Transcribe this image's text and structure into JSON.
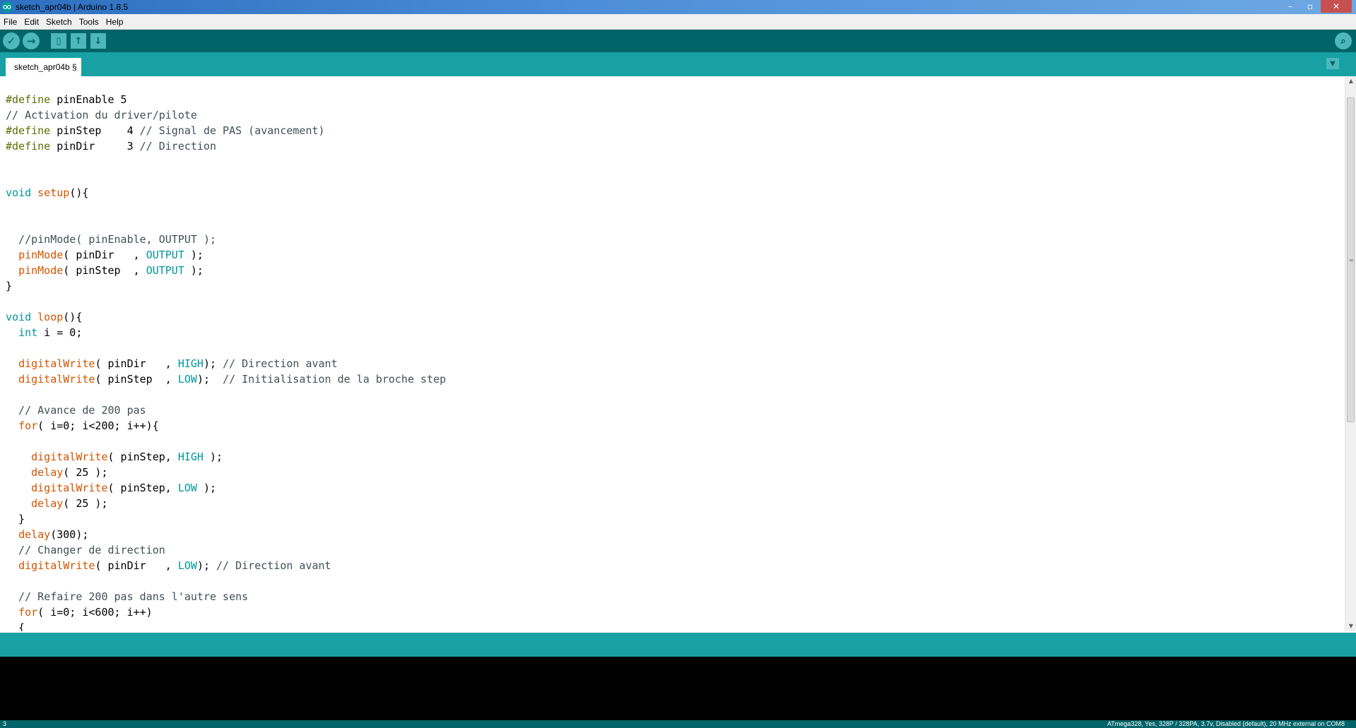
{
  "window": {
    "title": "sketch_apr04b | Arduino 1.8.5",
    "controls": {
      "minimize": "–",
      "maximize": "▫",
      "close": "✕"
    }
  },
  "menu": {
    "items": [
      "File",
      "Edit",
      "Sketch",
      "Tools",
      "Help"
    ]
  },
  "toolbar": {
    "verify_icon": "✓",
    "upload_icon": "→",
    "new_icon": "▯",
    "open_icon": "↑",
    "save_icon": "↓",
    "serial_monitor_icon": "⌕"
  },
  "tabs": {
    "active_label": "sketch_apr04b §",
    "menu_icon": "▼"
  },
  "code": [
    [
      {
        "t": "#define",
        "c": "k-pp"
      },
      {
        "t": " pinEnable 5"
      }
    ],
    [
      {
        "t": "// Activation du driver/pilote",
        "c": "k-cmt"
      }
    ],
    [
      {
        "t": "#define",
        "c": "k-pp"
      },
      {
        "t": " pinStep    4 "
      },
      {
        "t": "// Signal de PAS (avancement)",
        "c": "k-cmt"
      }
    ],
    [
      {
        "t": "#define",
        "c": "k-pp"
      },
      {
        "t": " pinDir     3 "
      },
      {
        "t": "// Direction",
        "c": "k-cmt"
      }
    ],
    [],
    [],
    [
      {
        "t": "void",
        "c": "k-type"
      },
      {
        "t": " "
      },
      {
        "t": "setup",
        "c": "k-fn"
      },
      {
        "t": "(){"
      }
    ],
    [],
    [],
    [
      {
        "t": "  //pinMode( pinEnable, OUTPUT );",
        "c": "k-cmt"
      }
    ],
    [
      {
        "t": "  "
      },
      {
        "t": "pinMode",
        "c": "k-fn"
      },
      {
        "t": "( pinDir   , "
      },
      {
        "t": "OUTPUT",
        "c": "k-const"
      },
      {
        "t": " );"
      }
    ],
    [
      {
        "t": "  "
      },
      {
        "t": "pinMode",
        "c": "k-fn"
      },
      {
        "t": "( pinStep  , "
      },
      {
        "t": "OUTPUT",
        "c": "k-const"
      },
      {
        "t": " );"
      }
    ],
    [
      {
        "t": "}"
      }
    ],
    [],
    [
      {
        "t": "void",
        "c": "k-type"
      },
      {
        "t": " "
      },
      {
        "t": "loop",
        "c": "k-fn"
      },
      {
        "t": "(){"
      }
    ],
    [
      {
        "t": "  "
      },
      {
        "t": "int",
        "c": "k-type"
      },
      {
        "t": " i = 0;"
      }
    ],
    [],
    [
      {
        "t": "  "
      },
      {
        "t": "digitalWrite",
        "c": "k-fn"
      },
      {
        "t": "( pinDir   , "
      },
      {
        "t": "HIGH",
        "c": "k-const"
      },
      {
        "t": "); "
      },
      {
        "t": "// Direction avant",
        "c": "k-cmt"
      }
    ],
    [
      {
        "t": "  "
      },
      {
        "t": "digitalWrite",
        "c": "k-fn"
      },
      {
        "t": "( pinStep  , "
      },
      {
        "t": "LOW",
        "c": "k-const"
      },
      {
        "t": ");  "
      },
      {
        "t": "// Initialisation de la broche step",
        "c": "k-cmt"
      }
    ],
    [],
    [
      {
        "t": "  // Avance de 200 pas",
        "c": "k-cmt"
      }
    ],
    [
      {
        "t": "  "
      },
      {
        "t": "for",
        "c": "k-fn"
      },
      {
        "t": "( i=0; i<200; i++){"
      }
    ],
    [],
    [
      {
        "t": "    "
      },
      {
        "t": "digitalWrite",
        "c": "k-fn"
      },
      {
        "t": "( pinStep, "
      },
      {
        "t": "HIGH",
        "c": "k-const"
      },
      {
        "t": " );"
      }
    ],
    [
      {
        "t": "    "
      },
      {
        "t": "delay",
        "c": "k-fn"
      },
      {
        "t": "( 25 );"
      }
    ],
    [
      {
        "t": "    "
      },
      {
        "t": "digitalWrite",
        "c": "k-fn"
      },
      {
        "t": "( pinStep, "
      },
      {
        "t": "LOW",
        "c": "k-const"
      },
      {
        "t": " );"
      }
    ],
    [
      {
        "t": "    "
      },
      {
        "t": "delay",
        "c": "k-fn"
      },
      {
        "t": "( 25 );"
      }
    ],
    [
      {
        "t": "  }"
      }
    ],
    [
      {
        "t": "  "
      },
      {
        "t": "delay",
        "c": "k-fn"
      },
      {
        "t": "(300);"
      }
    ],
    [
      {
        "t": "  // Changer de direction",
        "c": "k-cmt"
      }
    ],
    [
      {
        "t": "  "
      },
      {
        "t": "digitalWrite",
        "c": "k-fn"
      },
      {
        "t": "( pinDir   , "
      },
      {
        "t": "LOW",
        "c": "k-const"
      },
      {
        "t": "); "
      },
      {
        "t": "// Direction avant",
        "c": "k-cmt"
      }
    ],
    [],
    [
      {
        "t": "  // Refaire 200 pas dans l'autre sens",
        "c": "k-cmt"
      }
    ],
    [
      {
        "t": "  "
      },
      {
        "t": "for",
        "c": "k-fn"
      },
      {
        "t": "( i=0; i<600; i++)"
      }
    ],
    [
      {
        "t": "  {"
      }
    ]
  ],
  "scrollbar": {
    "up": "▲",
    "down": "▼",
    "grip": "≡"
  },
  "status": {
    "line_number": "3",
    "board": "ATmega328, Yes, 328P / 328PA, 3.7v, Disabled (default), 20 MHz external on COM8"
  },
  "colors": {
    "toolbar_bg": "#006468",
    "tab_bar_bg": "#17a1a5",
    "button_fg": "#4db7bb",
    "keyword_type": "#00979c",
    "keyword_function": "#d35400",
    "preprocessor": "#5e6d03",
    "comment": "#434f54",
    "console_bg": "#000000"
  }
}
